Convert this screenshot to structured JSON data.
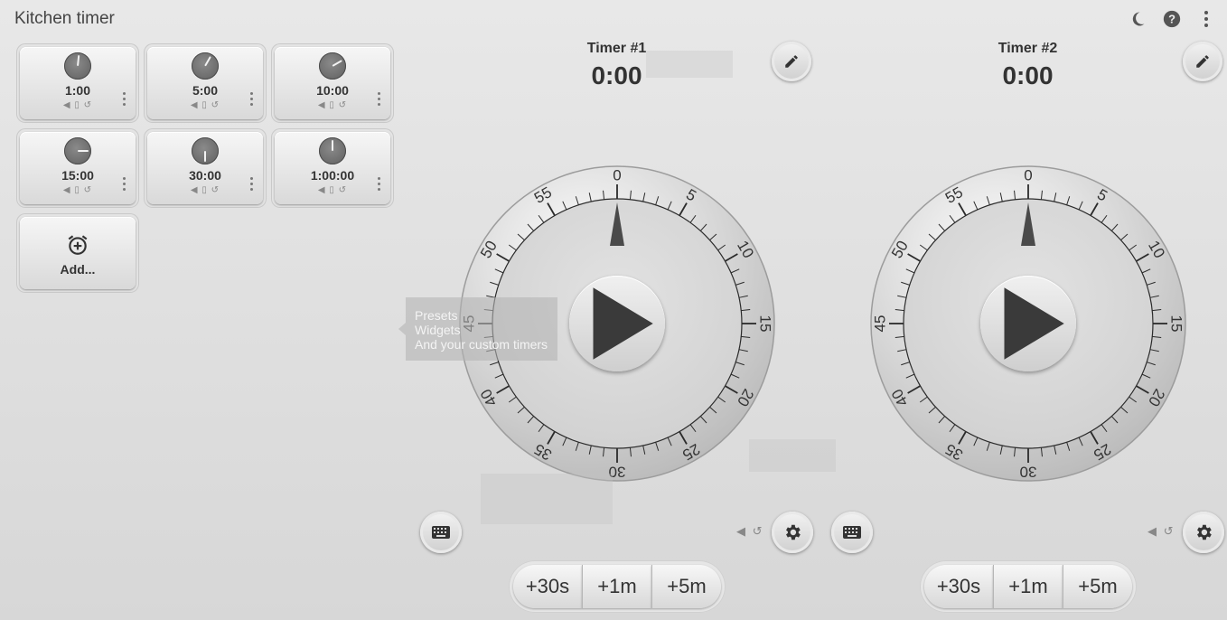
{
  "app": {
    "title": "Kitchen timer"
  },
  "toolbar": {
    "night_icon": "moon-icon",
    "help_icon": "help-icon",
    "more_icon": "more-vert-icon"
  },
  "presets": [
    {
      "label": "1:00",
      "minutes": 1
    },
    {
      "label": "5:00",
      "minutes": 5
    },
    {
      "label": "10:00",
      "minutes": 10
    },
    {
      "label": "15:00",
      "minutes": 15
    },
    {
      "label": "30:00",
      "minutes": 30
    },
    {
      "label": "1:00:00",
      "minutes": 60
    }
  ],
  "add_preset": {
    "label": "Add..."
  },
  "tooltip": {
    "line1": "Presets",
    "line2": "Widgets",
    "line3": "And your custom timers"
  },
  "dial_labels": [
    "0",
    "5",
    "10",
    "15",
    "20",
    "25",
    "30",
    "35",
    "40",
    "45",
    "50",
    "55"
  ],
  "timers": [
    {
      "name": "Timer #1",
      "time": "0:00",
      "quick_add": [
        "+30s",
        "+1m",
        "+5m"
      ]
    },
    {
      "name": "Timer #2",
      "time": "0:00",
      "quick_add": [
        "+30s",
        "+1m",
        "+5m"
      ]
    }
  ]
}
